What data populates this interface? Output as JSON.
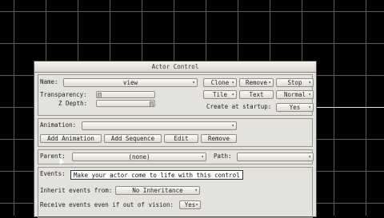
{
  "window": {
    "title": "Actor Control"
  },
  "actor": {
    "name_label": "Name:",
    "name_value": "view",
    "transparency_label": "Transparency:",
    "zdepth_label": "Z Depth:",
    "create_at_startup_label": "Create at startup:",
    "create_at_startup_value": "Yes"
  },
  "buttons": {
    "clone": "Clone",
    "remove": "Remove",
    "stop": "Stop",
    "tile": "Tile",
    "text": "Text",
    "normal": "Normal"
  },
  "animation": {
    "label": "Animation:",
    "value": "",
    "add_animation": "Add Animation",
    "add_sequence": "Add Sequence",
    "edit": "Edit",
    "remove": "Remove"
  },
  "parent": {
    "label": "Parent:",
    "value": "(none)",
    "path_label": "Path:",
    "path_value": ""
  },
  "events": {
    "label": "Events:",
    "tooltip": "Make your actor come to life with this control",
    "inherit_label": "Inherit events from:",
    "inherit_value": "No Inheritance",
    "receive_label": "Receive events even if out of vision:",
    "receive_value": "Yes"
  }
}
